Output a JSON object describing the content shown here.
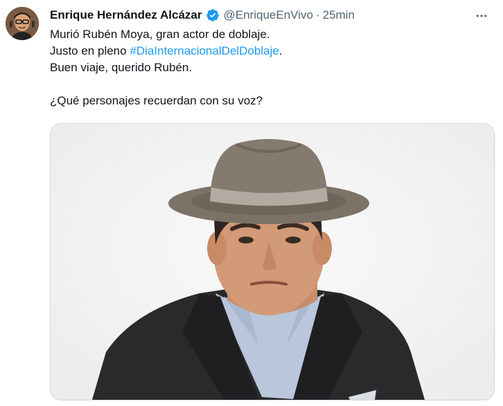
{
  "tweet": {
    "author_name": "Enrique Hernández Alcázar",
    "handle": "@EnriqueEnVivo",
    "separator": "·",
    "time": "25min",
    "more_icon": "more-horizontal-icon",
    "verified_icon": "verified-badge-icon",
    "text": {
      "line1": "Murió Rubén Moya, gran actor de doblaje.",
      "line2_prefix": "Justo en pleno ",
      "line2_hashtag": "#DiaInternacionalDelDoblaje",
      "line2_suffix": ".",
      "line3": "Buen viaje, querido Rubén.",
      "line4": "¿Qué personajes recuerdan con su voz?"
    },
    "media": {
      "kind": "photo"
    },
    "colors": {
      "accent": "#1d9bf0",
      "secondary_text": "#536471",
      "border": "#cfd9de"
    }
  }
}
